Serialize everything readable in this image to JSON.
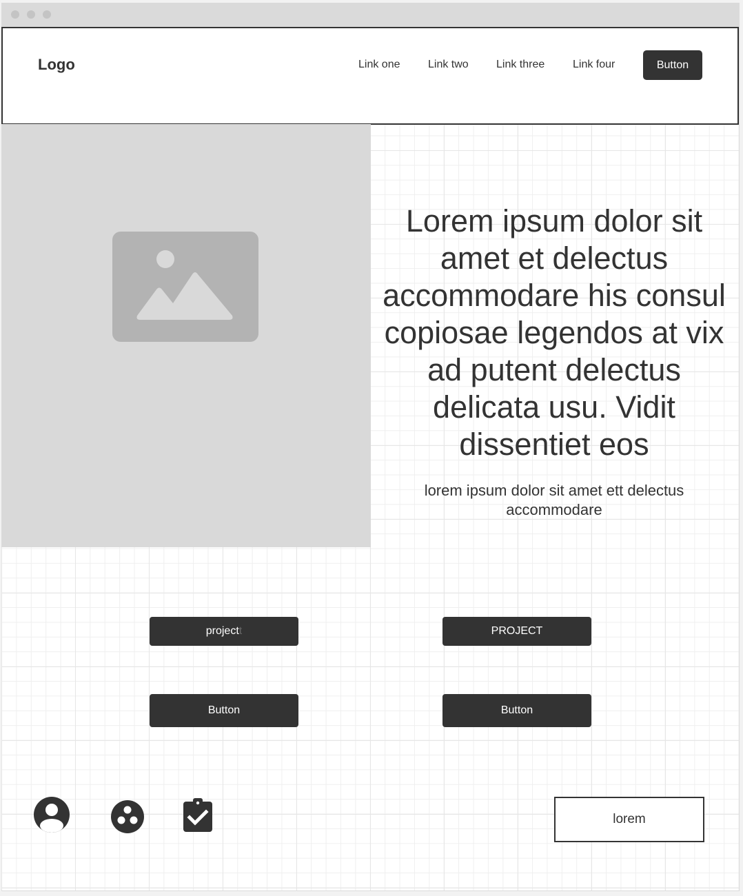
{
  "window": {
    "controls": [
      "close",
      "minimize",
      "maximize"
    ]
  },
  "navbar": {
    "logo": "Logo",
    "links": [
      "Link one",
      "Link two",
      "Link three",
      "Link four"
    ],
    "button_label": "Button"
  },
  "hero": {
    "image_icon": "image-placeholder-icon",
    "headline": "Lorem ipsum dolor sit amet et delectus accommodare his consul copiosae legendos at vix ad putent delectus delicata usu. Vidit dissentiet eos",
    "subtext": "lorem ipsum dolor sit amet  ett delectus accommodare"
  },
  "buttons": {
    "project_lower_main": "project",
    "project_lower_faint": "t",
    "project_upper": "PROJECT",
    "button_left": "Button",
    "button_right": "Button"
  },
  "footer": {
    "icons": [
      "account-circle-icon",
      "workspaces-icon",
      "assignment-turned-in-icon"
    ],
    "outline_button_label": "lorem"
  },
  "colors": {
    "dark": "#333333",
    "placeholder_bg": "#d9d9d9",
    "placeholder_icon": "#b3b3b3",
    "grid": "#e6e6e6"
  }
}
